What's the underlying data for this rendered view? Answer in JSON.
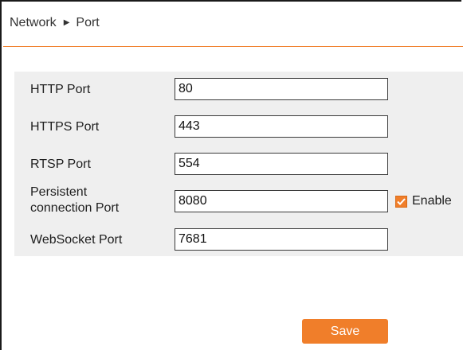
{
  "breadcrumb": {
    "section": "Network",
    "separator": "▶",
    "page": "Port"
  },
  "form": {
    "http_port": {
      "label": "HTTP Port",
      "value": "80"
    },
    "https_port": {
      "label": "HTTPS Port",
      "value": "443"
    },
    "rtsp_port": {
      "label": "RTSP Port",
      "value": "554"
    },
    "persistent_port": {
      "label_line1": "Persistent",
      "label_line2": "connection Port",
      "value": "8080",
      "enable_label": "Enable",
      "enabled": true
    },
    "websocket_port": {
      "label": "WebSocket Port",
      "value": "7681"
    }
  },
  "actions": {
    "save_label": "Save"
  },
  "colors": {
    "accent": "#f07e2a",
    "panel_bg": "#efefef",
    "text": "#1e1e1e"
  }
}
